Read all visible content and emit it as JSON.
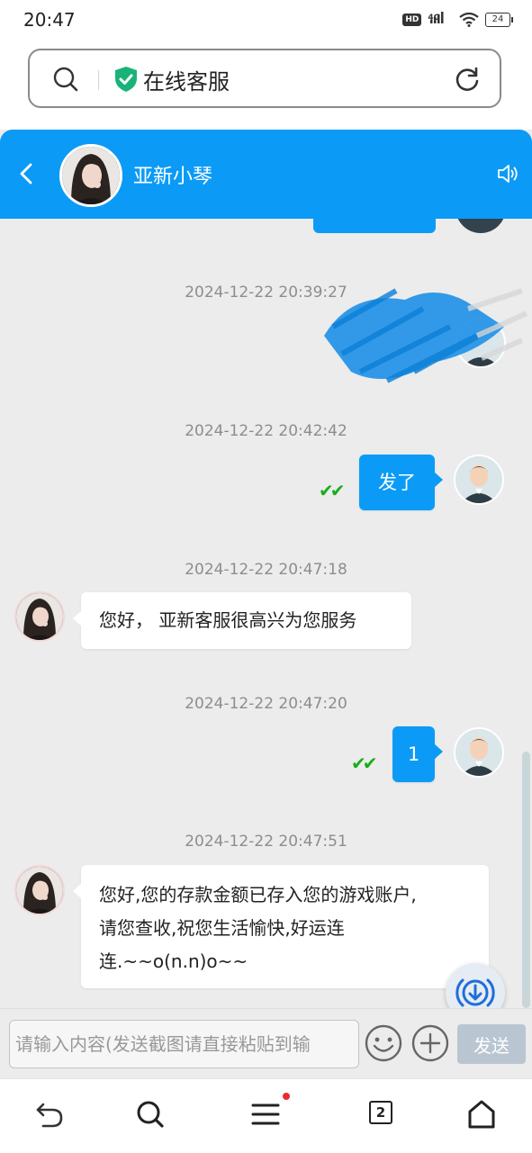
{
  "status_bar": {
    "time": "20:47",
    "hd": "HD",
    "network": "4G",
    "battery": "24"
  },
  "browser": {
    "page_title": "在线客服"
  },
  "chat_header": {
    "agent_name": "亚新小琴"
  },
  "messages": [
    {
      "timestamp": "2024-12-22 20:39:27",
      "direction": "out",
      "text": "",
      "obscured": true
    },
    {
      "timestamp": "2024-12-22 20:42:42",
      "direction": "out",
      "text": "发了",
      "read_ticks": "✔✔"
    },
    {
      "timestamp": "2024-12-22 20:47:18",
      "direction": "in",
      "text": "您好， 亚新客服很高兴为您服务"
    },
    {
      "timestamp": "2024-12-22 20:47:20",
      "direction": "out",
      "text": "1",
      "read_ticks": "✔✔"
    },
    {
      "timestamp": "2024-12-22 20:47:51",
      "direction": "in",
      "lines": [
        "您好,您的存款金额已存入您的游戏账户,",
        "请您查收,祝您生活愉快,好运连",
        "连.~~o(n.n)o~~"
      ]
    }
  ],
  "composer": {
    "placeholder": "请输入内容(发送截图请直接粘贴到输",
    "send_label": "发送"
  },
  "bottom_nav": {
    "tab_count": "2"
  },
  "colors": {
    "accent": "#0b9bf6",
    "read_tick": "#1aad19",
    "send_disabled": "#b9c6d2"
  }
}
